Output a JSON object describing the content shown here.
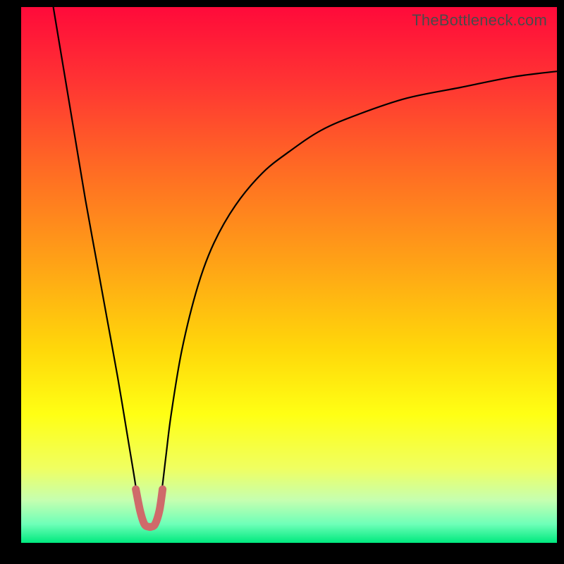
{
  "watermark": "TheBottleneck.com",
  "chart_data": {
    "type": "line",
    "title": "",
    "xlabel": "",
    "ylabel": "",
    "xlim": [
      0,
      100
    ],
    "ylim": [
      0,
      100
    ],
    "grid": false,
    "legend": false,
    "background_gradient_stops": [
      {
        "offset": 0.0,
        "color": "#ff0a3a"
      },
      {
        "offset": 0.14,
        "color": "#ff3433"
      },
      {
        "offset": 0.3,
        "color": "#ff6a24"
      },
      {
        "offset": 0.48,
        "color": "#ffa316"
      },
      {
        "offset": 0.64,
        "color": "#ffd80a"
      },
      {
        "offset": 0.76,
        "color": "#ffff14"
      },
      {
        "offset": 0.86,
        "color": "#f0ff60"
      },
      {
        "offset": 0.92,
        "color": "#c6ffb0"
      },
      {
        "offset": 0.965,
        "color": "#6effb8"
      },
      {
        "offset": 1.0,
        "color": "#00e97e"
      }
    ],
    "series": [
      {
        "name": "bottleneck-curve",
        "color": "#000000",
        "width": 2.2,
        "x": [
          6,
          8,
          10,
          12,
          14,
          16,
          18,
          20,
          21,
          22,
          23,
          24,
          25,
          26,
          27,
          28,
          30,
          33,
          36,
          40,
          45,
          50,
          56,
          63,
          72,
          82,
          92,
          100
        ],
        "y": [
          100,
          88,
          76,
          64,
          53,
          42,
          31,
          19,
          13,
          7,
          4,
          3,
          4,
          8,
          16,
          24,
          36,
          48,
          56,
          63,
          69,
          73,
          77,
          80,
          83,
          85,
          87,
          88
        ]
      },
      {
        "name": "highlight-valley",
        "color": "#cf6a6a",
        "width": 11,
        "linecap": "round",
        "x": [
          21.4,
          22.2,
          23.0,
          23.8,
          24.3,
          25.0,
          25.8,
          26.4
        ],
        "y": [
          10,
          6,
          3.5,
          3,
          3,
          3.5,
          6,
          10
        ]
      }
    ]
  }
}
